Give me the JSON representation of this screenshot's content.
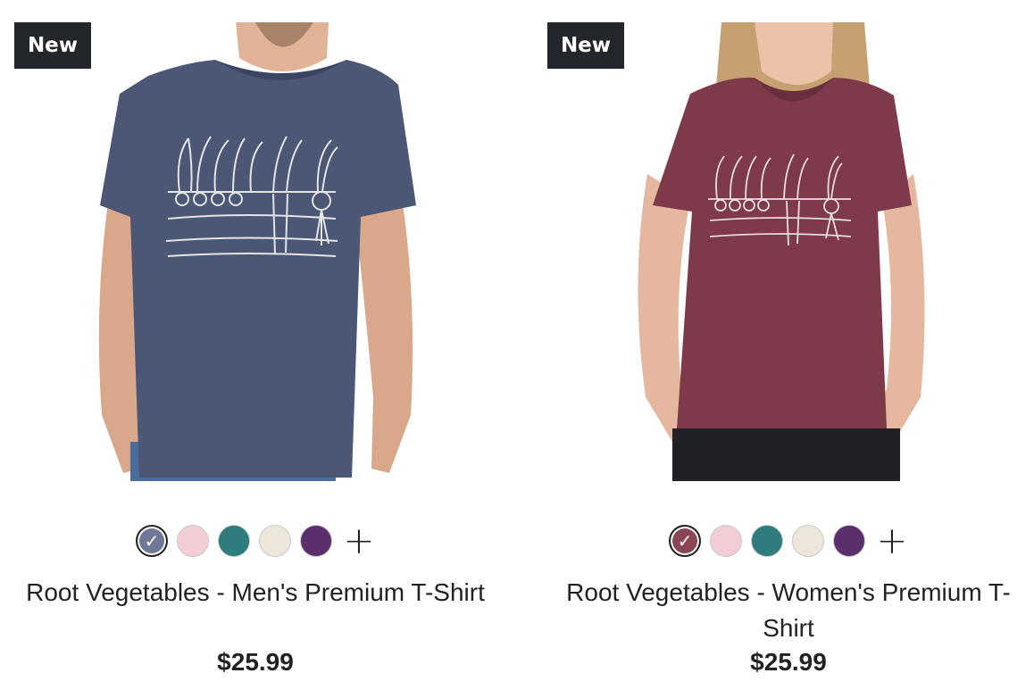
{
  "products": [
    {
      "badge": "New",
      "title": "Root Vegetables - Men's Premium T-Shirt",
      "price": "$25.99",
      "shirt_color": "#4b5775",
      "swatches": [
        {
          "color": "#6f7894",
          "selected": true
        },
        {
          "color": "#f2cdd6",
          "selected": false
        },
        {
          "color": "#2e7c7c",
          "selected": false
        },
        {
          "color": "#ece7da",
          "selected": false
        },
        {
          "color": "#5b2f6e",
          "selected": false
        }
      ],
      "more_icon": "+",
      "check_icon": "✓"
    },
    {
      "badge": "New",
      "title": "Root Vegetables - Women's Premium T-Shirt",
      "price": "$25.99",
      "shirt_color": "#7e3a4b",
      "swatches": [
        {
          "color": "#8a4654",
          "selected": true
        },
        {
          "color": "#f2cdd6",
          "selected": false
        },
        {
          "color": "#2e7c7c",
          "selected": false
        },
        {
          "color": "#ece7da",
          "selected": false
        },
        {
          "color": "#5b2f6e",
          "selected": false
        }
      ],
      "more_icon": "+",
      "check_icon": "✓"
    }
  ]
}
